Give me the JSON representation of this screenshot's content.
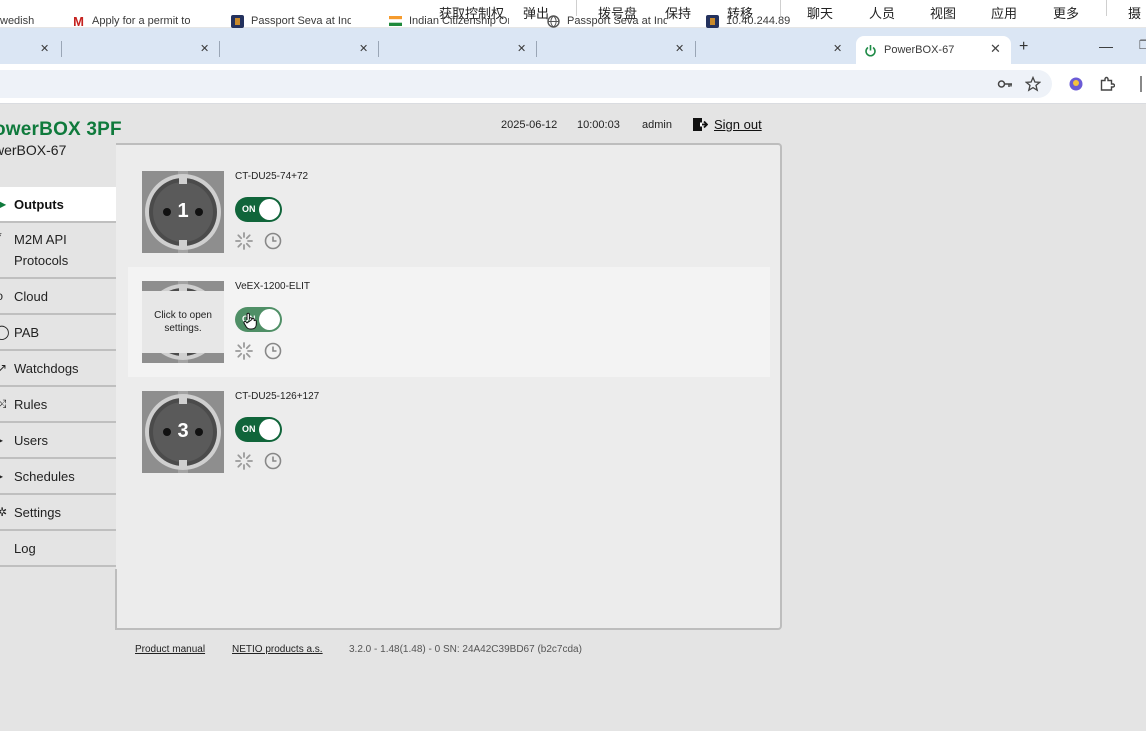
{
  "toolbar": {
    "items": [
      "获取控制权",
      "弹出",
      "拨号盘",
      "保持",
      "转移",
      "聊天",
      "人员",
      "视图",
      "应用",
      "更多",
      "摄"
    ]
  },
  "tabs": [
    {
      "title": "wedish",
      "favicon": "generic"
    },
    {
      "title": "Apply for a permit to",
      "favicon": "M"
    },
    {
      "title": "Passport Seva at India",
      "favicon": "emblem"
    },
    {
      "title": "Indian Citizenship On",
      "favicon": "flag"
    },
    {
      "title": "Passport Seva at India",
      "favicon": "globe"
    },
    {
      "title": "10.40.244.89",
      "favicon": "emblem"
    },
    {
      "title": "PowerBOX-67",
      "favicon": "power",
      "active": true
    }
  ],
  "browser": {
    "new_tab": "+",
    "icons": [
      "key-icon",
      "star-icon",
      "extension-badge-icon",
      "puzzle-icon"
    ]
  },
  "app": {
    "brand": "owerBOX 3PF",
    "device": "werBOX-67",
    "date": "2025-06-12",
    "time": "10:00:03",
    "user": "admin",
    "signout": "Sign out",
    "accent": "#0f7a3c",
    "toggle_on_color": "#10653a"
  },
  "nav": [
    {
      "label": "Outputs",
      "icon": "play-icon",
      "active": true
    },
    {
      "label1": "M2M API",
      "label2": "Protocols",
      "icon": "asterisk-icon"
    },
    {
      "label": "Cloud",
      "icon": "cloud-icon"
    },
    {
      "label": "PAB",
      "icon": "power-icon"
    },
    {
      "label": "Watchdogs",
      "icon": "watchdog-icon"
    },
    {
      "label": "Rules",
      "icon": "rules-icon"
    },
    {
      "label": "Users",
      "icon": "users-icon"
    },
    {
      "label": "Schedules",
      "icon": "schedule-icon"
    },
    {
      "label": "Settings",
      "icon": "gear-icon"
    },
    {
      "label": "Log",
      "icon": "log-icon"
    }
  ],
  "outputs": [
    {
      "number": "1",
      "name": "CT-DU25-74+72",
      "state": "ON"
    },
    {
      "number": "2",
      "name": "VeEX-1200-ELIT",
      "state": "ON",
      "tooltip": "Click to open settings."
    },
    {
      "number": "3",
      "name": "CT-DU25-126+127",
      "state": "ON"
    }
  ],
  "footer": {
    "manual": "Product manual",
    "company": "NETIO products a.s.",
    "version": "3.2.0 - 1.48(1.48) - 0 SN: 24A42C39BD67 (b2c7cda)"
  }
}
